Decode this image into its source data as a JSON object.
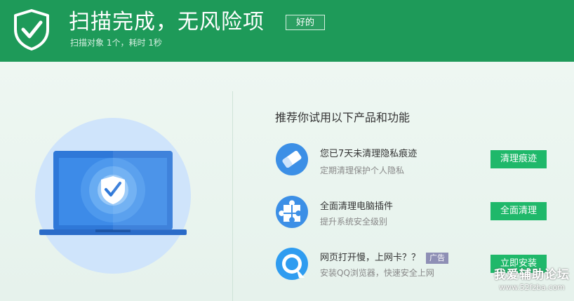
{
  "header": {
    "title": "扫描完成，无风险项",
    "ok_label": "好的",
    "subtitle": "扫描对象 1个，耗时 1秒"
  },
  "recommend": {
    "title": "推荐你试用以下产品和功能",
    "items": [
      {
        "icon": "eraser-icon",
        "title": "您已7天未清理隐私痕迹",
        "desc": "定期清理保护个人隐私",
        "button": "清理痕迹",
        "badge": ""
      },
      {
        "icon": "puzzle-icon",
        "title": "全面清理电脑插件",
        "desc": "提升系统安全级别",
        "button": "全面清理",
        "badge": ""
      },
      {
        "icon": "qq-browser-icon",
        "title": "网页打开慢，上网卡？？",
        "desc": "安装QQ浏览器，快速安全上网",
        "button": "立即安装",
        "badge": "广告"
      }
    ]
  },
  "watermark": {
    "line1": "我爱辅助论坛",
    "line2": "www.52fzba.com"
  },
  "colors": {
    "header_bg": "#1e9a59",
    "button_bg": "#1fb86a",
    "icon_blue": "#3c8fe6",
    "badge_bg": "#8e8fb5"
  }
}
